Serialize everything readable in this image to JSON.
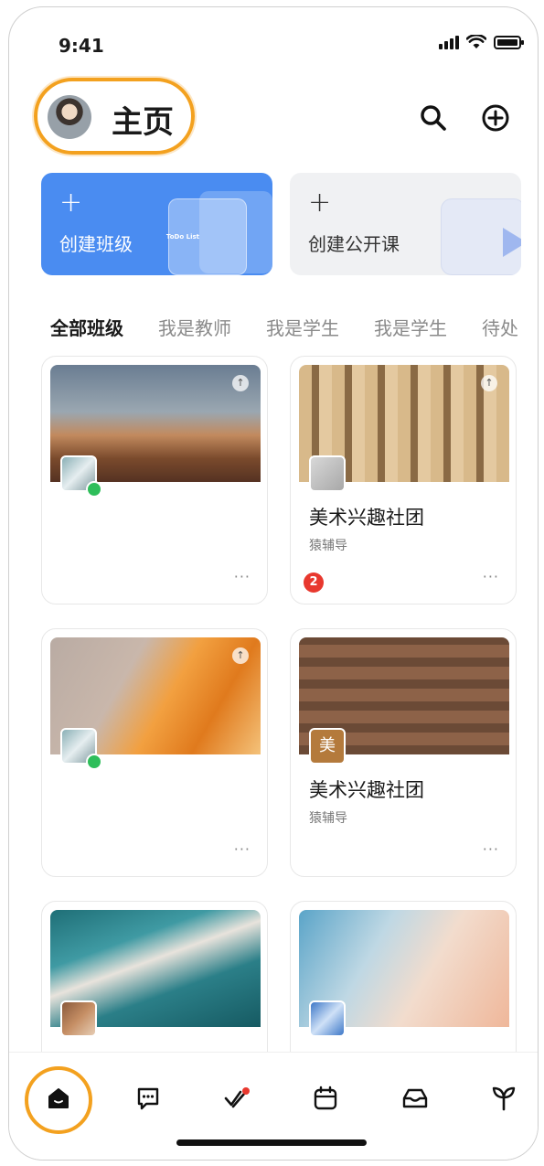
{
  "status_bar": {
    "time": "9:41"
  },
  "header": {
    "title": "主页"
  },
  "actions": [
    {
      "plus": "+",
      "label": "创建班级",
      "deco_text": "ToDo List"
    },
    {
      "plus": "+",
      "label": "创建公开课"
    }
  ],
  "tabs": [
    "全部班级",
    "我是教师",
    "我是学生",
    "我是学生",
    "待处"
  ],
  "cards": [
    {
      "name": "",
      "sub": "",
      "more": "···",
      "badge": "",
      "pinned": true
    },
    {
      "name": "美术兴趣社团",
      "sub": "猿辅导",
      "more": "···",
      "badge": "2",
      "pinned": true
    },
    {
      "name": "",
      "sub": "",
      "more": "···",
      "badge": "",
      "pinned": true
    },
    {
      "name": "美术兴趣社团",
      "sub": "猿辅导",
      "more": "···",
      "badge": "",
      "thumb_text": "美"
    }
  ],
  "icons": {
    "pin": "pin-top-icon",
    "search": "search-icon",
    "add": "plus-circle-icon"
  },
  "tabbar": [
    "home",
    "messages",
    "tasks",
    "calendar",
    "inbox",
    "growth"
  ],
  "colors": {
    "accent": "#4a8cf1",
    "highlight": "#f3a11f",
    "badge": "#e8382e",
    "online": "#2ebe5a"
  }
}
